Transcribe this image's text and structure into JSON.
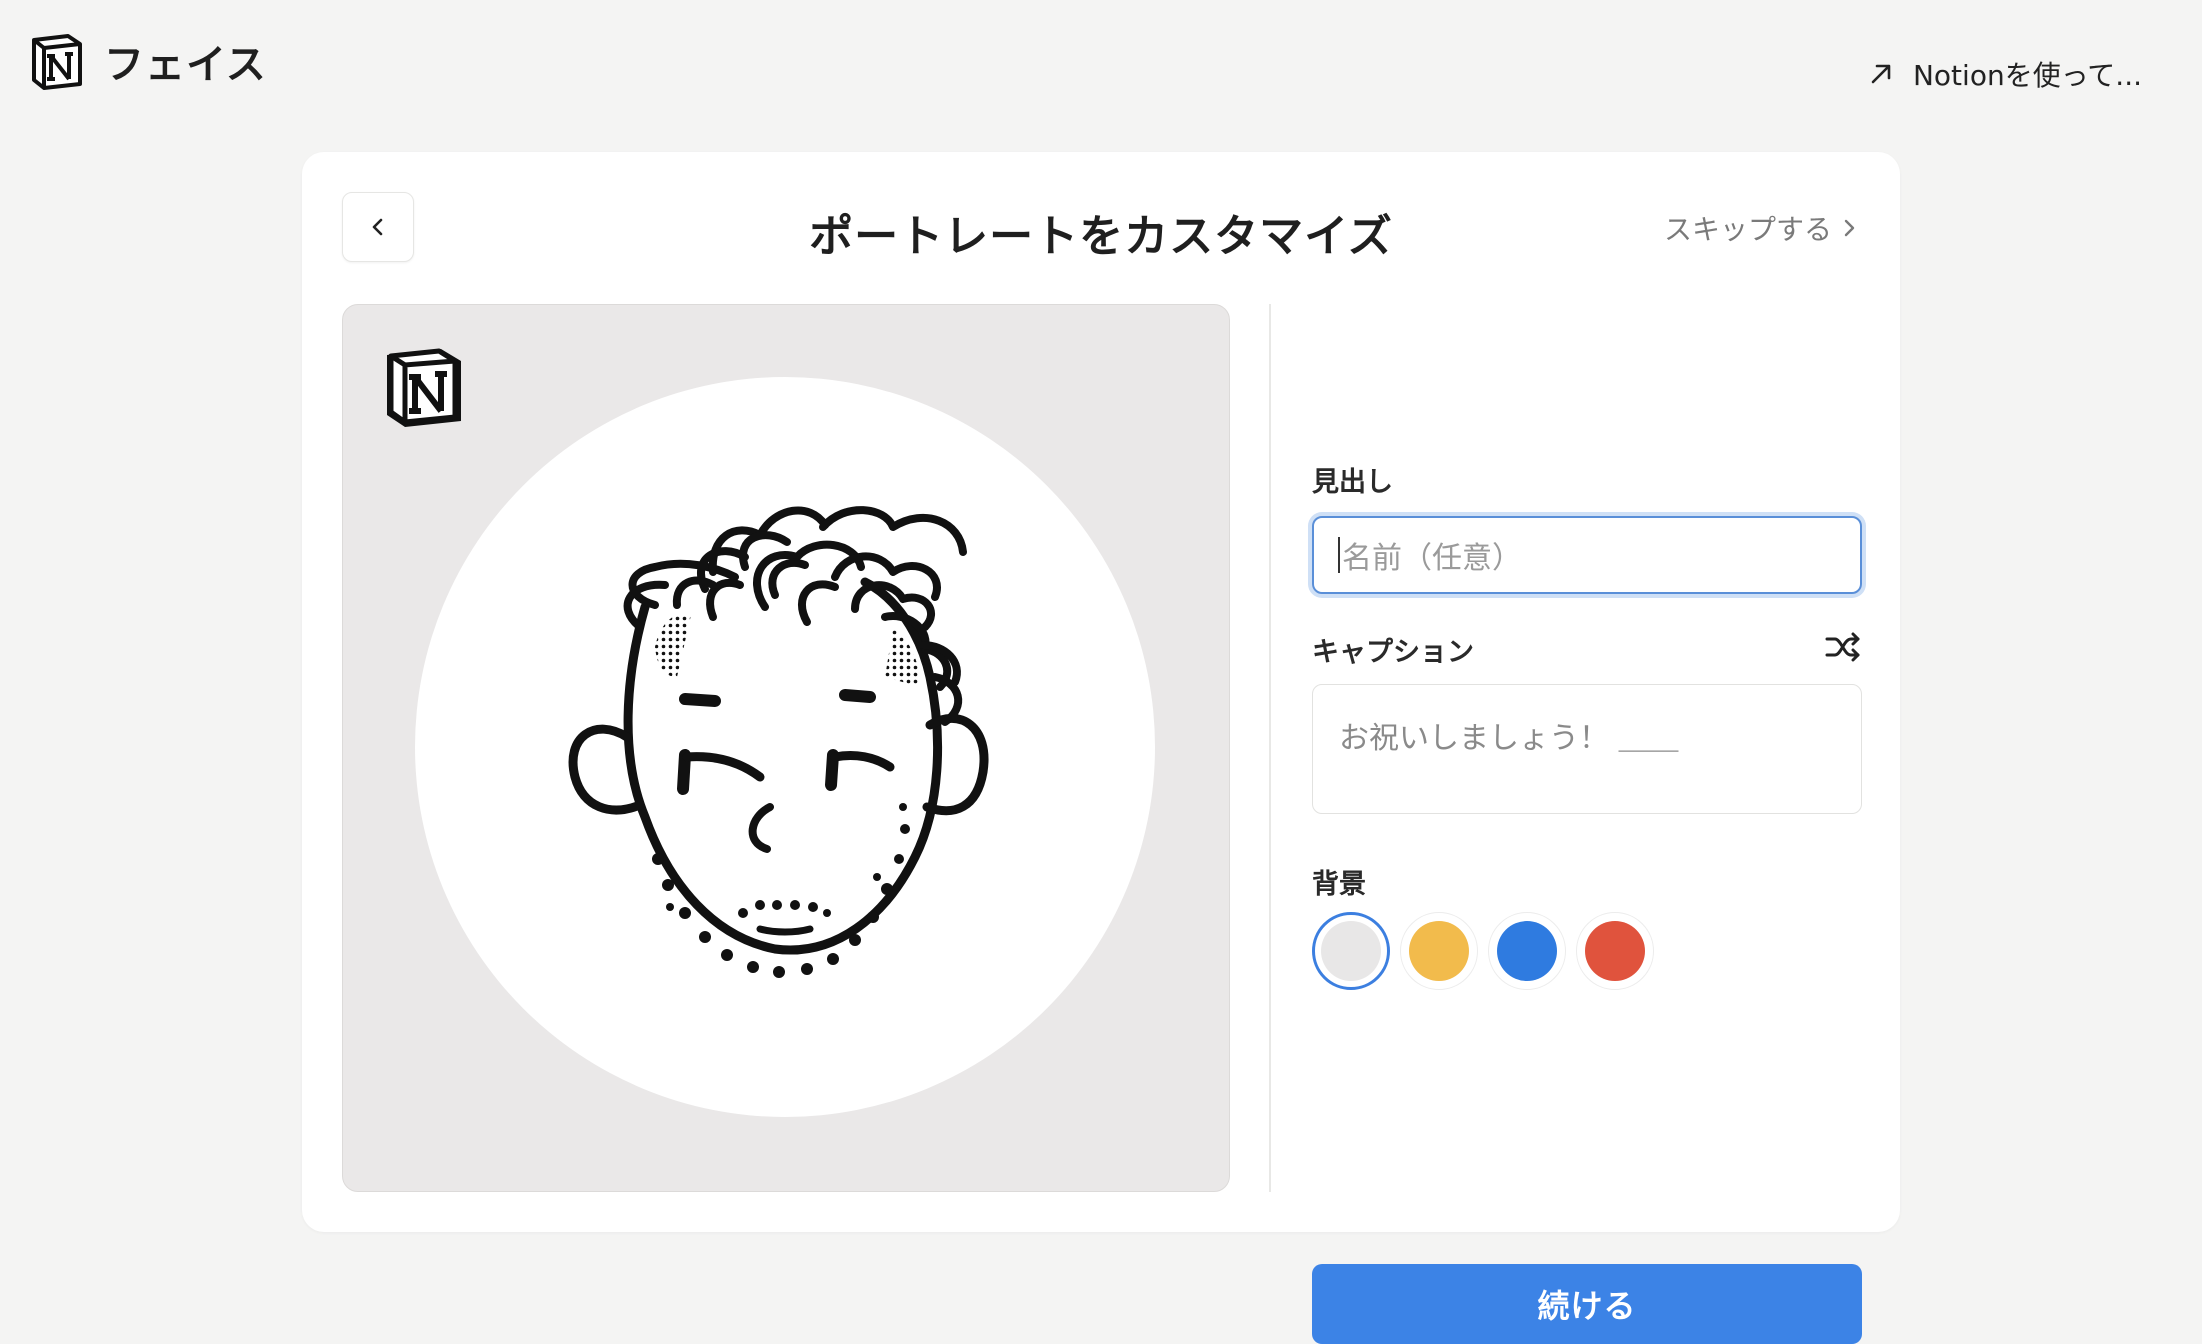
{
  "header": {
    "brand": "フェイス",
    "link_label": "Notionを使って..."
  },
  "card": {
    "title": "ポートレートをカスタマイズ",
    "skip_label": "スキップする"
  },
  "form": {
    "heading_label": "見出し",
    "heading_placeholder": "名前（任意）",
    "caption_label": "キャプション",
    "caption_value": "お祝いしましょう！ ＿＿",
    "background_label": "背景",
    "swatches": [
      {
        "name": "gray",
        "color": "#e8e7e7",
        "selected": true
      },
      {
        "name": "yellow",
        "color": "#f2bb4c",
        "selected": false
      },
      {
        "name": "blue",
        "color": "#2f7be0",
        "selected": false
      },
      {
        "name": "red",
        "color": "#e0533d",
        "selected": false
      }
    ],
    "continue_label": "続ける"
  },
  "icons": {
    "back": "chevron-left-icon",
    "skip": "chevron-right-icon",
    "external": "arrow-up-right-icon",
    "shuffle": "shuffle-icon",
    "logo": "notion-logo-icon"
  },
  "colors": {
    "accent": "#3c83e6",
    "page_bg": "#f4f4f3",
    "preview_bg": "#eae8e8"
  }
}
